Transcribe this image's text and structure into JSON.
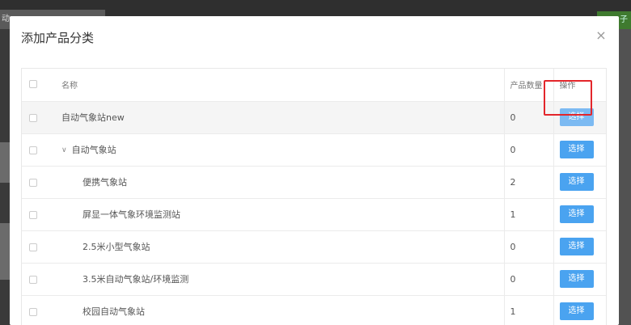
{
  "background": {
    "tab_text": "动",
    "right_button_text": "子"
  },
  "modal": {
    "title": "添加产品分类",
    "close_glyph": "×"
  },
  "table": {
    "headers": {
      "name": "名称",
      "count": "产品数量",
      "op": "操作"
    },
    "rows": [
      {
        "name": "自动气象站new",
        "count": "0",
        "level": 1,
        "button": "选择"
      },
      {
        "name": "自动气象站",
        "count": "0",
        "level": 2,
        "button": "选择"
      },
      {
        "name": "便携气象站",
        "count": "2",
        "level": 3,
        "button": "选择"
      },
      {
        "name": "屏显一体气象环境监测站",
        "count": "1",
        "level": 3,
        "button": "选择"
      },
      {
        "name": "2.5米小型气象站",
        "count": "0",
        "level": 3,
        "button": "选择"
      },
      {
        "name": "3.5米自动气象站/环境监测",
        "count": "0",
        "level": 3,
        "button": "选择"
      },
      {
        "name": "校园自动气象站",
        "count": "1",
        "level": 3,
        "button": "选择"
      }
    ]
  },
  "colors": {
    "accent": "#4aa3f0",
    "highlight_box": "#e3262b"
  }
}
